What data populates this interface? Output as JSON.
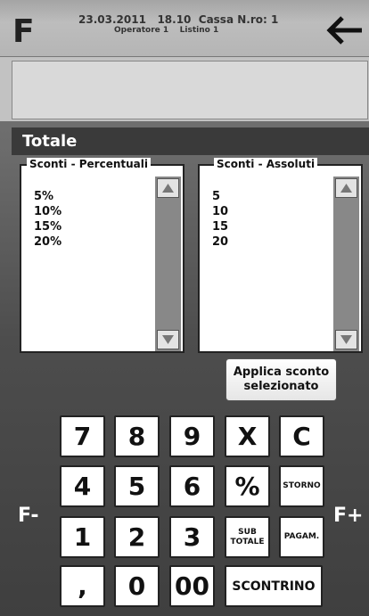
{
  "header": {
    "logo": "F",
    "line1": "23.03.2011   18.10  Cassa N.ro: 1",
    "line2": "Operatore 1    Listino 1",
    "back_icon": "arrow-left-icon"
  },
  "totale_label": "Totale",
  "lists": {
    "percentuali": {
      "title": "Sconti - Percentuali",
      "items": [
        "5%",
        "10%",
        "15%",
        "20%"
      ]
    },
    "assoluti": {
      "title": "Sconti - Assoluti",
      "items": [
        "5",
        "10",
        "15",
        "20"
      ]
    }
  },
  "apply_button": {
    "line1": "Applica sconto",
    "line2": "selezionato"
  },
  "keypad": {
    "k7": "7",
    "k8": "8",
    "k9": "9",
    "kx": "X",
    "kc": "C",
    "k4": "4",
    "k5": "5",
    "k6": "6",
    "kpct": "%",
    "storno": "STORNO",
    "k1": "1",
    "k2": "2",
    "k3": "3",
    "subtotale_1": "SUB",
    "subtotale_2": "TOTALE",
    "pagam": "PAGAM.",
    "comma": ",",
    "k0": "0",
    "k00": "00",
    "scontrino": "SCONTRINO"
  },
  "f_minus": "F-",
  "f_plus": "F+",
  "colors": {
    "background": "#5a5a5a",
    "header": "#b3b3b3",
    "totale_bar": "#3a3a3a",
    "key": "#ffffff"
  }
}
